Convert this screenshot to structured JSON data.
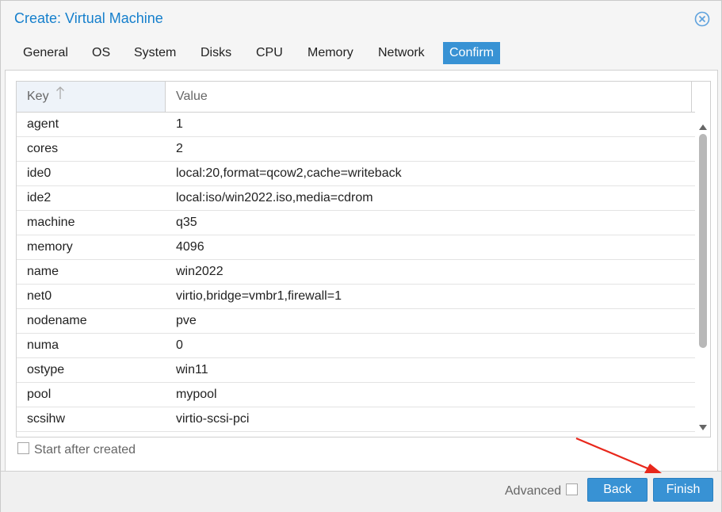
{
  "dialog": {
    "title": "Create: Virtual Machine",
    "close_icon": "close-circle-icon"
  },
  "tabs": [
    {
      "label": "General"
    },
    {
      "label": "OS"
    },
    {
      "label": "System"
    },
    {
      "label": "Disks"
    },
    {
      "label": "CPU"
    },
    {
      "label": "Memory"
    },
    {
      "label": "Network"
    },
    {
      "label": "Confirm",
      "active": true
    }
  ],
  "grid": {
    "columns": {
      "key": "Key",
      "value": "Value"
    },
    "sort_icon": "sort-ascending-arrow-icon",
    "rows": [
      {
        "key": "agent",
        "value": "1"
      },
      {
        "key": "cores",
        "value": "2"
      },
      {
        "key": "ide0",
        "value": "local:20,format=qcow2,cache=writeback"
      },
      {
        "key": "ide2",
        "value": "local:iso/win2022.iso,media=cdrom"
      },
      {
        "key": "machine",
        "value": "q35"
      },
      {
        "key": "memory",
        "value": "4096"
      },
      {
        "key": "name",
        "value": "win2022"
      },
      {
        "key": "net0",
        "value": "virtio,bridge=vmbr1,firewall=1"
      },
      {
        "key": "nodename",
        "value": "pve"
      },
      {
        "key": "numa",
        "value": "0"
      },
      {
        "key": "ostype",
        "value": "win11"
      },
      {
        "key": "pool",
        "value": "mypool"
      },
      {
        "key": "scsihw",
        "value": "virtio-scsi-pci"
      }
    ]
  },
  "start_after_created": {
    "label": "Start after created",
    "checked": false
  },
  "footer": {
    "advanced_label": "Advanced",
    "advanced_checked": false,
    "back_label": "Back",
    "finish_label": "Finish"
  },
  "colors": {
    "accent": "#3892d4",
    "title": "#157fcc",
    "annotation_arrow": "#e8271b"
  }
}
